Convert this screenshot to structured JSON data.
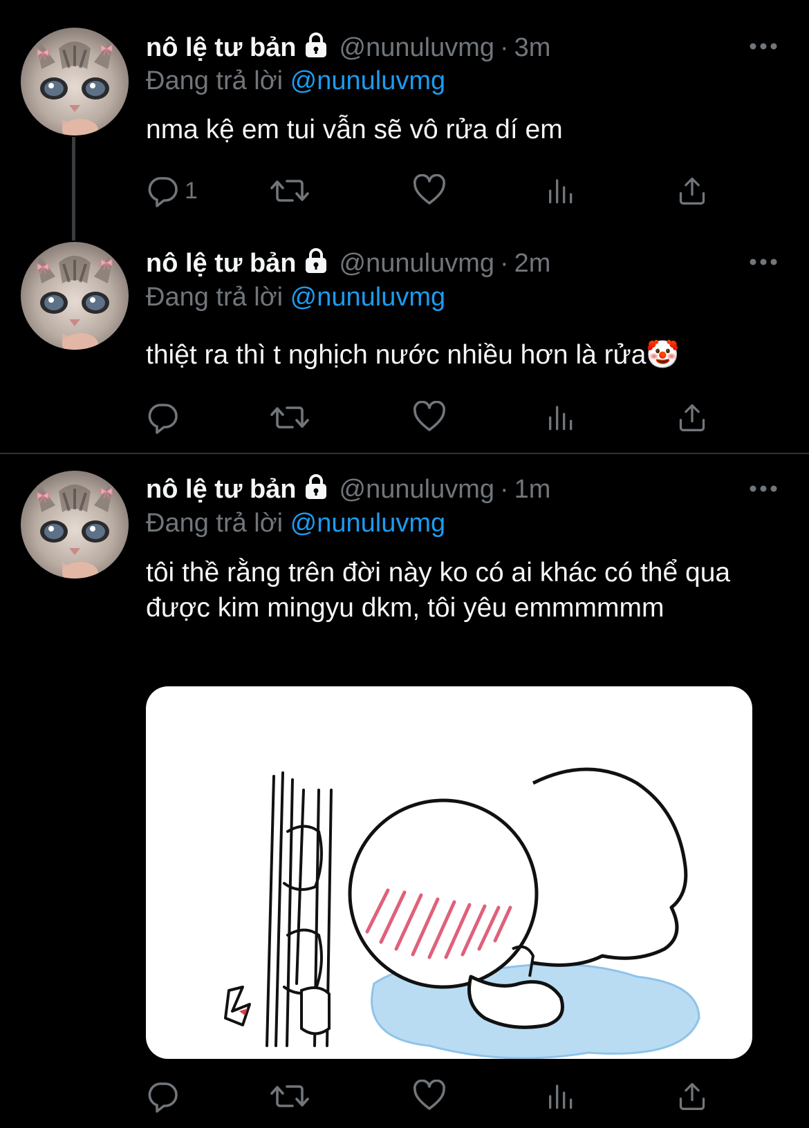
{
  "colors": {
    "background": "#000000",
    "text": "#e7e9ea",
    "muted": "#71767b",
    "accent": "#1d9bf0"
  },
  "icons": {
    "lock": "lock-icon",
    "more": "more-dots-icon",
    "reply": "reply-icon",
    "retweet": "retweet-icon",
    "like": "heart-icon",
    "views": "views-icon",
    "share": "share-icon"
  },
  "tweets": [
    {
      "name": "nô lệ tư bản",
      "handle": "@nunuluvmg",
      "separator": "·",
      "time": "3m",
      "reply_prefix": "Đang trả lời",
      "reply_mention": "@nunuluvmg",
      "text": "nma kệ em tui vẫn sẽ vô rửa dí em",
      "reply_count": "1"
    },
    {
      "name": "nô lệ tư bản",
      "handle": "@nunuluvmg",
      "separator": "·",
      "time": "2m",
      "reply_prefix": "Đang trả lời",
      "reply_mention": "@nunuluvmg",
      "text": "thiệt ra thì t nghịch nước nhiều hơn là rửa🤡",
      "reply_count": ""
    },
    {
      "name": "nô lệ tư bản",
      "handle": "@nunuluvmg",
      "separator": "·",
      "time": "1m",
      "reply_prefix": "Đang trả lời",
      "reply_mention": "@nunuluvmg",
      "text": "tôi thề rằng trên đời này ko có ai khác có thể qua được kim mingyu dkm, tôi yêu emmmmmm",
      "reply_count": ""
    }
  ]
}
